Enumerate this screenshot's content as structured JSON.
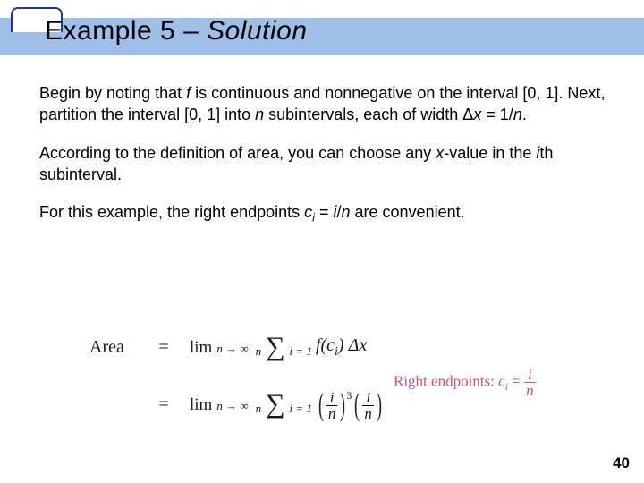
{
  "title": {
    "prefix": "Example 5 – ",
    "solution": "Solution"
  },
  "para1": {
    "t1": "Begin by noting that ",
    "f": "f",
    "t2": " is continuous and nonnegative on the interval [0, 1]. Next, partition the interval [0, 1] into ",
    "n": "n",
    "t3": " subintervals, each of width Δ",
    "x": "x",
    "t4": " = 1/",
    "n2": "n",
    "t5": "."
  },
  "para2": {
    "t1": "According to the definition of area, you can choose any ",
    "x": "x",
    "t2": "-value  in the ",
    "i": "i",
    "t3": "th subinterval."
  },
  "para3": {
    "t1": "For this example, the right endpoints ",
    "c": "c",
    "sub": "i",
    "t2": " = ",
    "i": "i",
    "t3": "/",
    "n": "n",
    "t4": " are convenient."
  },
  "math": {
    "area": "Area",
    "eq": "=",
    "lim": "lim",
    "limsub": "n → ∞",
    "sigma_top": "n",
    "sigma_bot": "i = 1",
    "row1_fc": "f",
    "row1_ci": "c",
    "row1_cisub": "i",
    "row1_dx": " Δx",
    "frac_i": "i",
    "frac_n": "n",
    "frac_1": "1",
    "cube": "3"
  },
  "note": {
    "label": "Right endpoints:  ",
    "c": "c",
    "ci": "i",
    "eq": " = ",
    "num": "i",
    "den": "n"
  },
  "page": "40"
}
